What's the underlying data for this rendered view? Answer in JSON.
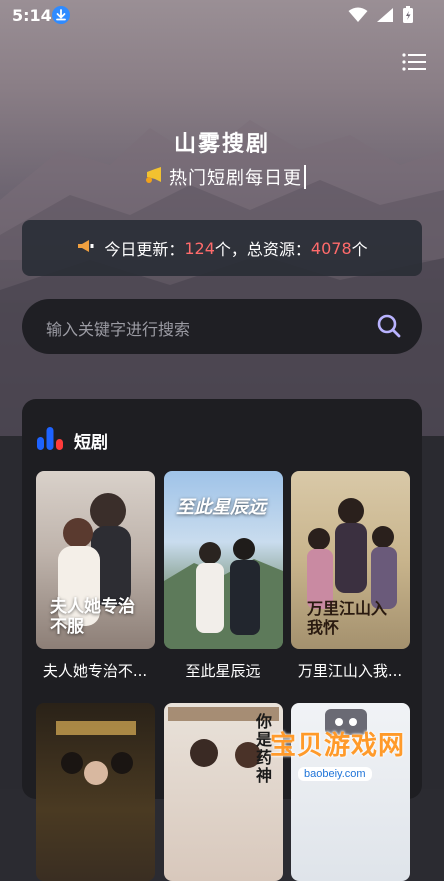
{
  "status_bar": {
    "time": "5:14"
  },
  "header": {
    "app_title": "山雾搜剧",
    "tagline": "热门短剧每日更"
  },
  "update_info": {
    "prefix": "今日更新：",
    "today_count": "124",
    "mid": "个，总资源：",
    "total_count": "4078",
    "suffix": "个"
  },
  "search": {
    "placeholder": "输入关键字进行搜索"
  },
  "section": {
    "title": "短剧",
    "items": [
      {
        "title": "夫人她专治不...",
        "poster_text": "夫人她专治不服"
      },
      {
        "title": "至此星辰远",
        "poster_text": "至此星辰远"
      },
      {
        "title": "万里江山入我...",
        "poster_text": "万里江山入我怀"
      }
    ],
    "more_poster_texts": [
      "你是药神"
    ]
  },
  "watermark": {
    "text": "宝贝游戏网",
    "url": "baobeiy.com"
  },
  "colors": {
    "accent_number": "#ff6b6b",
    "card_bg": "#1e1e22",
    "search_bg": "#1f1f24",
    "icon_blue": "#1e63ff"
  }
}
